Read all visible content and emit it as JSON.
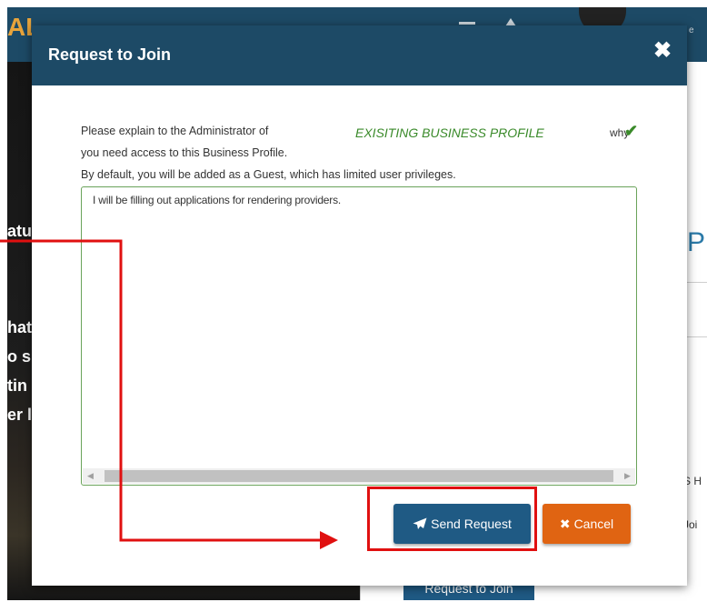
{
  "background": {
    "logo_text": "AL",
    "header_tag": "e",
    "left_fragments": [
      "atu",
      "hat",
      "o s",
      "tin",
      "er l"
    ],
    "right_fragment": "P",
    "right_small_1": "S H",
    "right_small_2": "Joi",
    "request_to_join_button": "Request to Join"
  },
  "modal": {
    "title": "Request to Join",
    "close_icon": "close-x-icon",
    "instructions": {
      "line1": "Please explain to the Administrator of",
      "profile_name": "EXISITING BUSINESS PROFILE",
      "why": "why",
      "line2": "you need access to this Business Profile.",
      "line3": "By default, you will be added as a Guest, which has limited user privileges."
    },
    "message": {
      "value": "I will be filling out applications for rendering providers."
    },
    "buttons": {
      "send_label": "Send Request",
      "send_icon": "paper-plane-icon",
      "cancel_label": "Cancel",
      "cancel_icon": "times-icon"
    }
  },
  "colors": {
    "header": "#1d4a66",
    "primary_button": "#1f5a84",
    "cancel_button": "#e06412",
    "accent_green": "#3a8a2a",
    "annotation_red": "#e01010"
  }
}
